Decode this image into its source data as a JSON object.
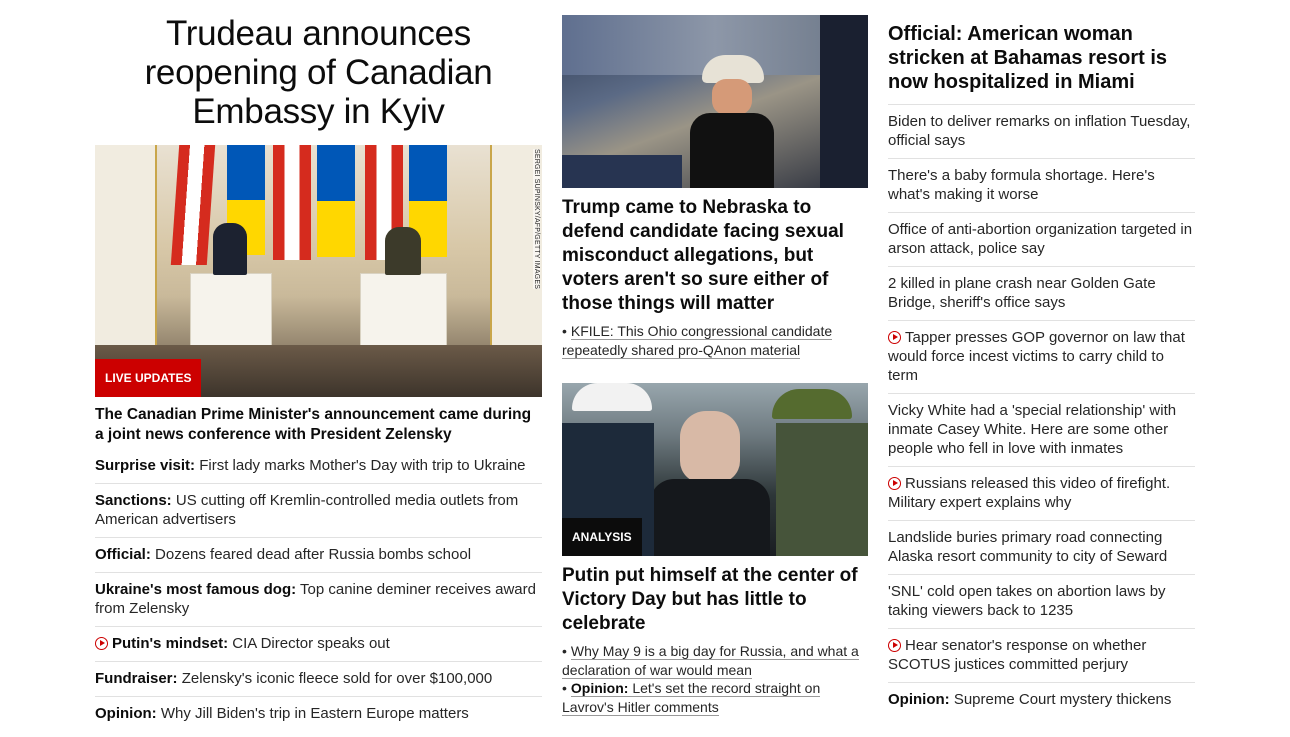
{
  "col1": {
    "headline": "Trudeau announces reopening of Canadian Embassy in Kyiv",
    "image_alt": "Trudeau and Zelensky press conference",
    "image_credit": "SERGEI SUPINSKY/AFP/GETTY IMAGES",
    "badge": "LIVE UPDATES",
    "subhead": "The Canadian Prime Minister's announcement came during a joint news conference with President Zelensky",
    "items": [
      {
        "kicker": "Surprise visit:",
        "text": "First lady marks Mother's Day with trip to Ukraine",
        "video": false
      },
      {
        "kicker": "Sanctions:",
        "text": "US cutting off Kremlin-controlled media outlets from American advertisers",
        "video": false
      },
      {
        "kicker": "Official:",
        "text": "Dozens feared dead after Russia bombs school",
        "video": false
      },
      {
        "kicker": "Ukraine's most famous dog:",
        "text": "Top canine deminer receives award from Zelensky",
        "video": false
      },
      {
        "kicker": "Putin's mindset:",
        "text": "CIA Director speaks out",
        "video": true
      },
      {
        "kicker": "Fundraiser:",
        "text": "Zelensky's iconic fleece sold for over $100,000",
        "video": false
      },
      {
        "kicker": "Opinion:",
        "text": "Why Jill Biden's trip in Eastern Europe matters",
        "video": false
      }
    ]
  },
  "col2": {
    "card1": {
      "title": "Trump came to Nebraska to defend candidate facing sexual misconduct allegations, but voters aren't so sure either of those things will matter",
      "links": [
        {
          "kicker": "",
          "text": "KFILE: This Ohio congressional candidate repeatedly shared pro-QAnon material"
        }
      ]
    },
    "card2": {
      "badge": "ANALYSIS",
      "title": "Putin put himself at the center of Victory Day but has little to celebrate",
      "links": [
        {
          "kicker": "",
          "text": "Why May 9 is a big day for Russia, and what a declaration of war would mean"
        },
        {
          "kicker": "Opinion:",
          "text": "Let's set the record straight on Lavrov's Hitler comments"
        }
      ]
    }
  },
  "col3": {
    "headline": "Official: American woman stricken at Bahamas resort is now hospitalized in Miami",
    "items": [
      {
        "kicker": "",
        "text": "Biden to deliver remarks on inflation Tuesday, official says",
        "video": false
      },
      {
        "kicker": "",
        "text": "There's a baby formula shortage. Here's what's making it worse",
        "video": false
      },
      {
        "kicker": "",
        "text": "Office of anti-abortion organization targeted in arson attack, police say",
        "video": false
      },
      {
        "kicker": "",
        "text": "2 killed in plane crash near Golden Gate Bridge, sheriff's office says",
        "video": false
      },
      {
        "kicker": "",
        "text": "Tapper presses GOP governor on law that would force incest victims to carry child to term",
        "video": true
      },
      {
        "kicker": "",
        "text": "Vicky White had a 'special relationship' with inmate Casey White. Here are some other people who fell in love with inmates",
        "video": false
      },
      {
        "kicker": "",
        "text": "Russians released this video of firefight. Military expert explains why",
        "video": true
      },
      {
        "kicker": "",
        "text": "Landslide buries primary road connecting Alaska resort community to city of Seward",
        "video": false
      },
      {
        "kicker": "",
        "text": "'SNL' cold open takes on abortion laws by taking viewers back to 1235",
        "video": false
      },
      {
        "kicker": "",
        "text": "Hear senator's response on whether SCOTUS justices committed perjury",
        "video": true
      },
      {
        "kicker": "Opinion:",
        "text": "Supreme Court mystery thickens",
        "video": false
      }
    ]
  },
  "colors": {
    "accent": "#cc0000",
    "text": "#0c0c0c",
    "divider": "#e1e1e1"
  }
}
